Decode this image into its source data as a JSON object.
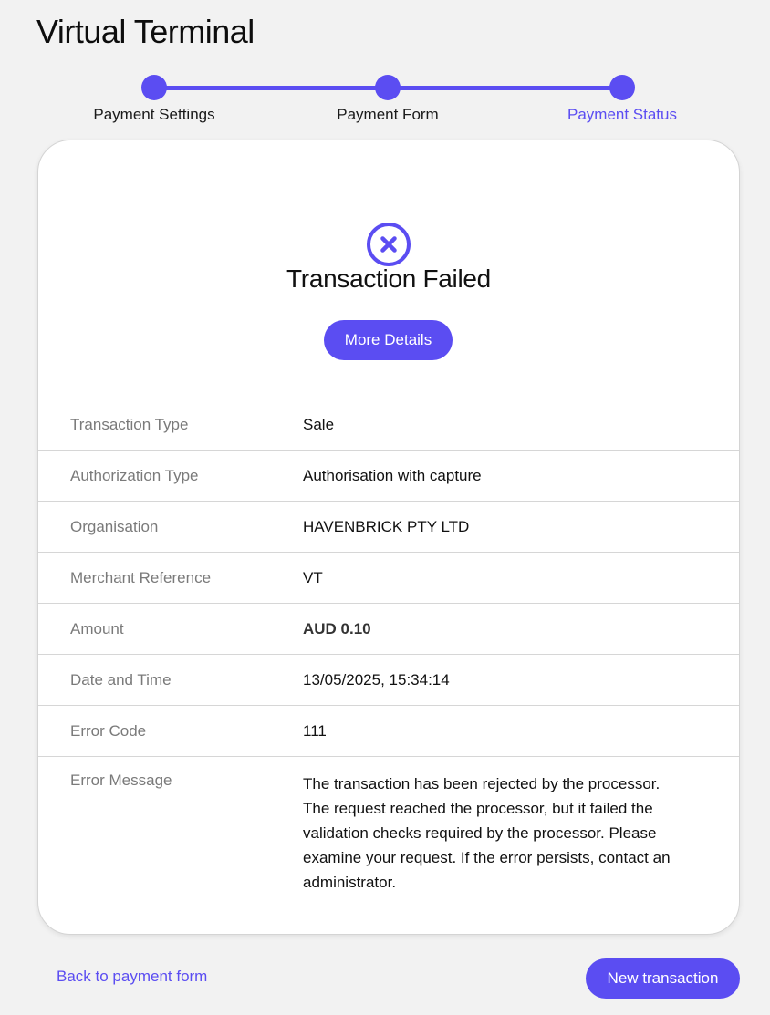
{
  "page": {
    "title": "Virtual Terminal"
  },
  "stepper": {
    "steps": [
      {
        "label": "Payment Settings",
        "state": "complete"
      },
      {
        "label": "Payment Form",
        "state": "complete"
      },
      {
        "label": "Payment Status",
        "state": "active"
      }
    ]
  },
  "status": {
    "icon": "x-circle-icon",
    "title": "Transaction Failed",
    "more_details_label": "More Details"
  },
  "details": [
    {
      "label": "Transaction Type",
      "value": "Sale"
    },
    {
      "label": "Authorization Type",
      "value": "Authorisation with capture"
    },
    {
      "label": "Organisation",
      "value": "HAVENBRICK PTY LTD"
    },
    {
      "label": "Merchant Reference",
      "value": "VT"
    },
    {
      "label": "Amount",
      "value": "AUD 0.10"
    },
    {
      "label": "Date and Time",
      "value": "13/05/2025, 15:34:14"
    },
    {
      "label": "Error Code",
      "value": "111"
    },
    {
      "label": "Error Message",
      "value": "The transaction has been rejected by the processor. The request reached the processor, but it failed the validation checks required by the processor. Please examine your request. If the error persists, contact an administrator."
    }
  ],
  "footer": {
    "back_label": "Back to payment form",
    "new_transaction_label": "New transaction"
  },
  "colors": {
    "accent": "#5b4df2",
    "background": "#f2f2f2",
    "card": "#ffffff"
  }
}
